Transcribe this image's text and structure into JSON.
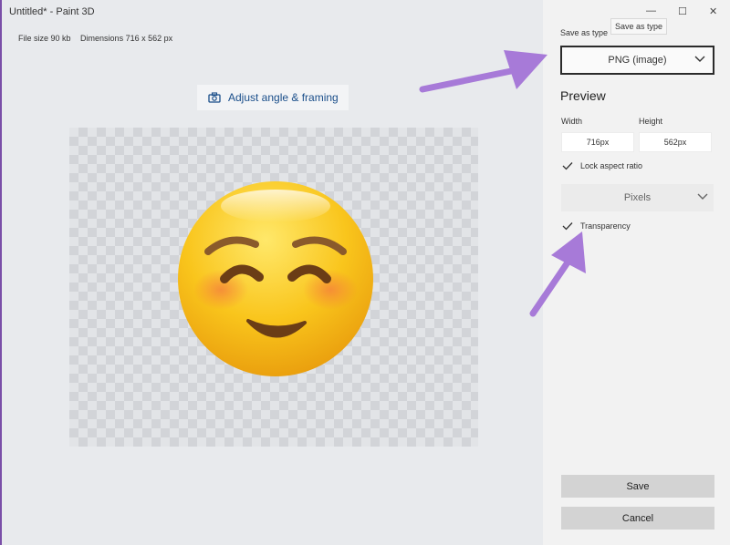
{
  "window": {
    "title": "Untitled* - Paint 3D",
    "controls": {
      "minimize": "—",
      "maximize": "☐",
      "close": "✕"
    }
  },
  "main": {
    "file_size": "File size  90 kb",
    "dimensions": "Dimensions  716 x 562 px",
    "adjust_label": "Adjust angle & framing"
  },
  "panel": {
    "save_as_type_label": "Save as type",
    "tooltip": "Save as type",
    "type_value": "PNG (image)",
    "preview_heading": "Preview",
    "width_label": "Width",
    "height_label": "Height",
    "width_value": "716px",
    "height_value": "562px",
    "lock_label": "Lock aspect ratio",
    "units_value": "Pixels",
    "transparency_label": "Transparency",
    "save_label": "Save",
    "cancel_label": "Cancel"
  },
  "colors": {
    "accent_arrow": "#a77ad8",
    "link_blue": "#1a4e8a",
    "emoji_face": "#f7c21a",
    "emoji_blush": "#f39a4a"
  }
}
